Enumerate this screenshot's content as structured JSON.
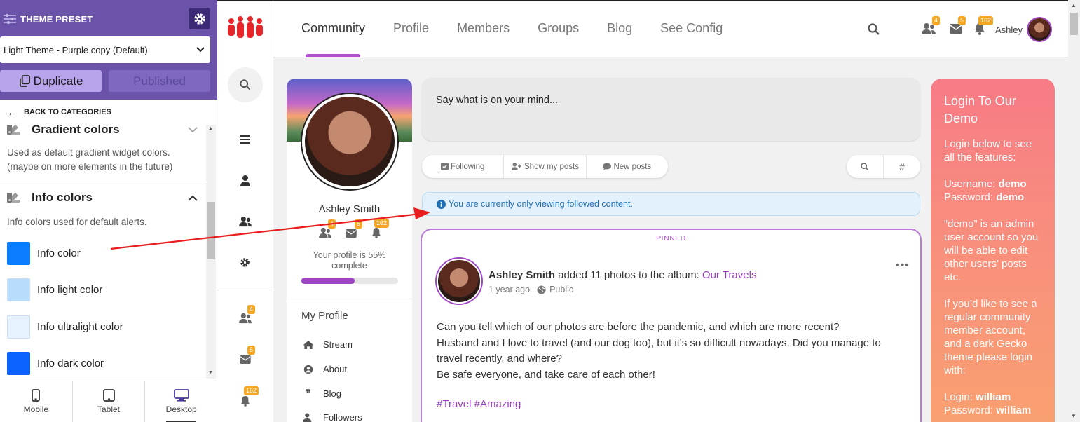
{
  "customizer": {
    "title": "THEME PRESET",
    "preset_value": "Light Theme - Purple copy (Default)",
    "duplicate_label": "Duplicate",
    "published_label": "Published",
    "back_label": "BACK TO CATEGORIES",
    "gradient": {
      "title": "Gradient colors",
      "desc1": "Used as default gradient widget colors.",
      "desc2": "(maybe on more elements in the future)"
    },
    "info": {
      "title": "Info colors",
      "desc": "Info colors used for default alerts.",
      "items": [
        {
          "label": "Info color",
          "color": "#0a7cff"
        },
        {
          "label": "Info light color",
          "color": "#b8dcfc"
        },
        {
          "label": "Info ultralight color",
          "color": "#e6f2fd"
        },
        {
          "label": "Info dark color",
          "color": "#0a62ff"
        }
      ]
    },
    "devices": {
      "mobile": "Mobile",
      "tablet": "Tablet",
      "desktop": "Desktop"
    }
  },
  "header": {
    "nav": [
      "Community",
      "Profile",
      "Members",
      "Groups",
      "Blog",
      "See Config"
    ],
    "badges": {
      "friends": "4",
      "messages": "5",
      "notifications": "162"
    },
    "user_name": "Ashley"
  },
  "sidebar_badges": {
    "friends": "4",
    "messages": "5",
    "notifications": "162"
  },
  "profile": {
    "name": "Ashley Smith",
    "badges": {
      "friends": "4",
      "messages": "5",
      "notifications": "162"
    },
    "completion_text": "Your profile is 55% complete",
    "completion": 0.55,
    "my_profile": "My Profile",
    "menu": [
      "Stream",
      "About",
      "Blog",
      "Followers"
    ]
  },
  "feed": {
    "composer_placeholder": "Say what is on your mind...",
    "filters": [
      "Following",
      "Show my posts",
      "New posts"
    ],
    "info_text": "You are currently only viewing followed content.",
    "post": {
      "pinned": "PINNED",
      "author": "Ashley Smith",
      "action": " added 11 photos to the album: ",
      "album": "Our Travels",
      "time": "1 year ago",
      "visibility": "Public",
      "line1": "Can you tell which of our photos are before the pandemic, and which are more recent?",
      "line2": "Husband and I love to travel (and our dog too), but it's so difficult nowadays. Did you manage to travel recently, and where?",
      "line3": "Be safe everyone, and take care of each other!",
      "tags": "#Travel #Amazing"
    }
  },
  "login_card": {
    "title": "Login To Our Demo",
    "p1": "Login below to see all the features:",
    "username_label": "Username: ",
    "username": "demo",
    "password_label": "Password: ",
    "password": "demo",
    "p3": "“demo” is an admin user account so you will be able to edit other users’ posts etc.",
    "p4": "If you’d like to see a regular community member account, and a dark Gecko theme please login with:",
    "login_label": "Login: ",
    "login": "william",
    "password2_label": "Password: ",
    "password2": "william"
  }
}
